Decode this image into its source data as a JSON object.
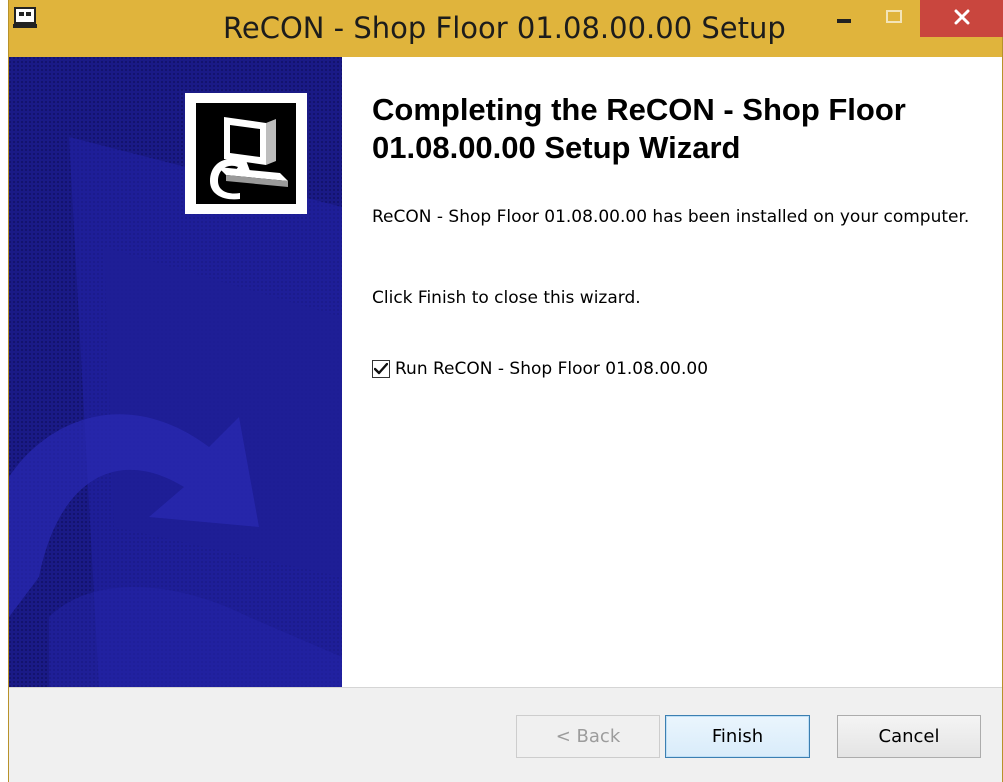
{
  "window": {
    "title": "ReCON - Shop Floor 01.08.00.00 Setup",
    "icons": {
      "system": "installer-app-icon",
      "minimize": "minimize-icon",
      "maximize": "maximize-icon",
      "close": "close-icon"
    },
    "colors": {
      "titlebar": "#e0b43c",
      "close_button": "#c9463e",
      "banner": "#1a1a86"
    }
  },
  "banner": {
    "logo_icon": "computer-install-icon"
  },
  "content": {
    "heading": "Completing the ReCON - Shop Floor 01.08.00.00 Setup Wizard",
    "description": "ReCON - Shop Floor 01.08.00.00 has been installed on your computer.",
    "hint": "Click Finish to close this wizard.",
    "run_checkbox": {
      "label": "Run ReCON - Shop Floor 01.08.00.00",
      "checked": true
    }
  },
  "footer": {
    "back_label": "< Back",
    "back_enabled": false,
    "finish_label": "Finish",
    "cancel_label": "Cancel"
  }
}
